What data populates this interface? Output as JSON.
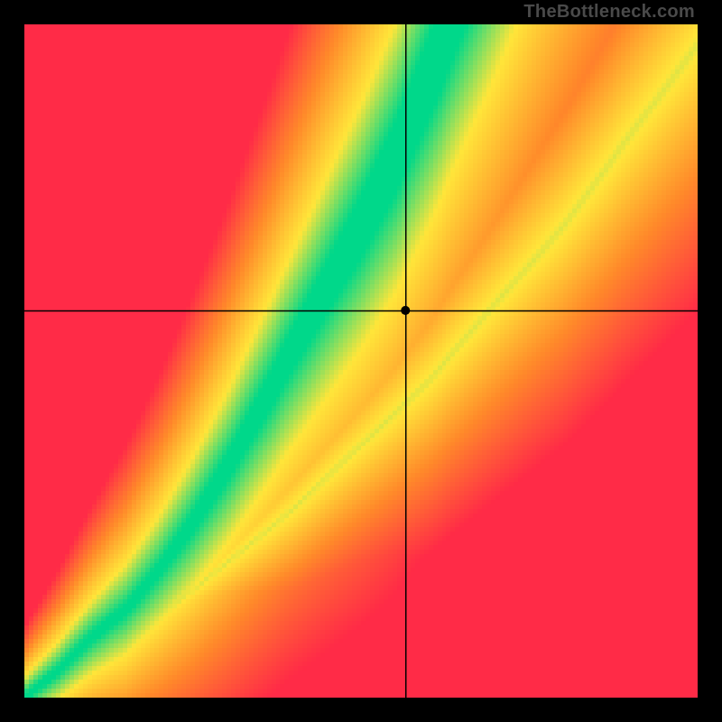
{
  "watermark": "TheBottleneck.com",
  "colors": {
    "black": "#000000",
    "red": "#ff2b47",
    "orange": "#ff8a2a",
    "yellow": "#ffe63a",
    "green": "#00d88a",
    "cross": "#000000",
    "dot": "#000000"
  },
  "chart_data": {
    "type": "heatmap",
    "title": "",
    "xlabel": "",
    "ylabel": "",
    "xlim": [
      0,
      1
    ],
    "ylim": [
      0,
      1
    ],
    "grid_size": 150,
    "crosshair": {
      "x": 0.566,
      "y": 0.575
    },
    "dot_radius_px": 5,
    "optimal_curve_comment": "green ridge y = f(x); piecewise, roughly y ≈ x below 0.3 then steeper, curving up toward (0.62, 1.0)",
    "optimal_curve": [
      {
        "x": 0.0,
        "y": 0.0
      },
      {
        "x": 0.05,
        "y": 0.04
      },
      {
        "x": 0.1,
        "y": 0.09
      },
      {
        "x": 0.15,
        "y": 0.13
      },
      {
        "x": 0.2,
        "y": 0.19
      },
      {
        "x": 0.25,
        "y": 0.26
      },
      {
        "x": 0.3,
        "y": 0.34
      },
      {
        "x": 0.35,
        "y": 0.43
      },
      {
        "x": 0.4,
        "y": 0.52
      },
      {
        "x": 0.45,
        "y": 0.61
      },
      {
        "x": 0.5,
        "y": 0.7
      },
      {
        "x": 0.55,
        "y": 0.8
      },
      {
        "x": 0.6,
        "y": 0.92
      },
      {
        "x": 0.63,
        "y": 1.0
      }
    ],
    "secondary_curve_comment": "faint yellow secondary ridge to the right of the main one, shallower",
    "secondary_curve": [
      {
        "x": 0.0,
        "y": 0.0
      },
      {
        "x": 0.2,
        "y": 0.12
      },
      {
        "x": 0.4,
        "y": 0.28
      },
      {
        "x": 0.6,
        "y": 0.47
      },
      {
        "x": 0.8,
        "y": 0.7
      },
      {
        "x": 1.0,
        "y": 0.97
      }
    ],
    "band_width_comment": "half-width of green band in y-units, grows with x",
    "band_width": [
      {
        "x": 0.0,
        "w": 0.005
      },
      {
        "x": 0.2,
        "w": 0.01
      },
      {
        "x": 0.4,
        "w": 0.03
      },
      {
        "x": 0.6,
        "w": 0.06
      },
      {
        "x": 0.7,
        "w": 0.08
      }
    ]
  }
}
